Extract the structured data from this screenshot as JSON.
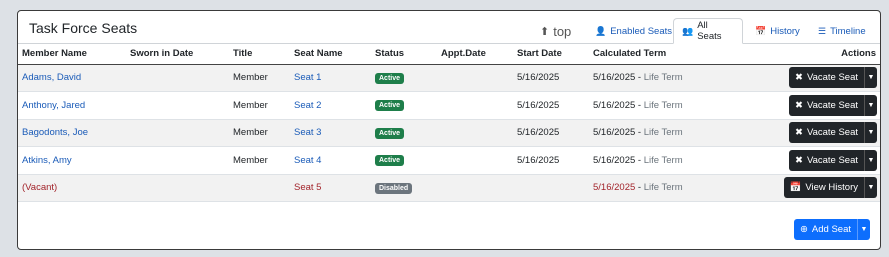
{
  "panel": {
    "title": "Task Force Seats"
  },
  "tabs": [
    {
      "label": "top",
      "icon": "arrow-up-circle-icon"
    },
    {
      "label": "Enabled Seats",
      "icon": "user-icon"
    },
    {
      "label": "All Seats",
      "icon": "users-icon",
      "active": true
    },
    {
      "label": "History",
      "icon": "calendar-icon"
    },
    {
      "label": "Timeline",
      "icon": "sliders-icon"
    }
  ],
  "table": {
    "headers": [
      "Member Name",
      "Sworn in Date",
      "Title",
      "Seat Name",
      "Status",
      "Appt.Date",
      "Start Date",
      "Calculated Term",
      "Actions"
    ],
    "rows": [
      {
        "member": "Adams, David",
        "sworn": "",
        "title": "Member",
        "seat": "Seat 1",
        "status": "Active",
        "appt": "",
        "start": "5/16/2025",
        "term_date": "5/16/2025",
        "term_sep": " - ",
        "term_type": "Life Term",
        "action": "Vacate Seat",
        "action_icon": "x-icon"
      },
      {
        "member": "Anthony, Jared",
        "sworn": "",
        "title": "Member",
        "seat": "Seat 2",
        "status": "Active",
        "appt": "",
        "start": "5/16/2025",
        "term_date": "5/16/2025",
        "term_sep": " - ",
        "term_type": "Life Term",
        "action": "Vacate Seat",
        "action_icon": "x-icon"
      },
      {
        "member": "Bagodonts, Joe",
        "sworn": "",
        "title": "Member",
        "seat": "Seat 3",
        "status": "Active",
        "appt": "",
        "start": "5/16/2025",
        "term_date": "5/16/2025",
        "term_sep": " - ",
        "term_type": "Life Term",
        "action": "Vacate Seat",
        "action_icon": "x-icon"
      },
      {
        "member": "Atkins, Amy",
        "sworn": "",
        "title": "Member",
        "seat": "Seat 4",
        "status": "Active",
        "appt": "",
        "start": "5/16/2025",
        "term_date": "5/16/2025",
        "term_sep": " - ",
        "term_type": "Life Term",
        "action": "Vacate Seat",
        "action_icon": "x-icon"
      },
      {
        "member": "(Vacant)",
        "sworn": "",
        "title": "",
        "seat": "Seat 5",
        "status": "Disabled",
        "appt": "",
        "start": "",
        "term_date": "5/16/2025",
        "term_sep": " - ",
        "term_type": "Life Term",
        "action": "View History",
        "action_icon": "calendar-icon"
      }
    ]
  },
  "add_seat": {
    "label": "Add Seat",
    "icon": "plus-circle-icon"
  },
  "colors": {
    "link": "#1a5bb8",
    "vacant": "#a3242b",
    "active_badge": "#1e7e4a",
    "disabled_badge": "#6c757d",
    "dark_button": "#212529",
    "primary_button": "#0d6efd"
  }
}
